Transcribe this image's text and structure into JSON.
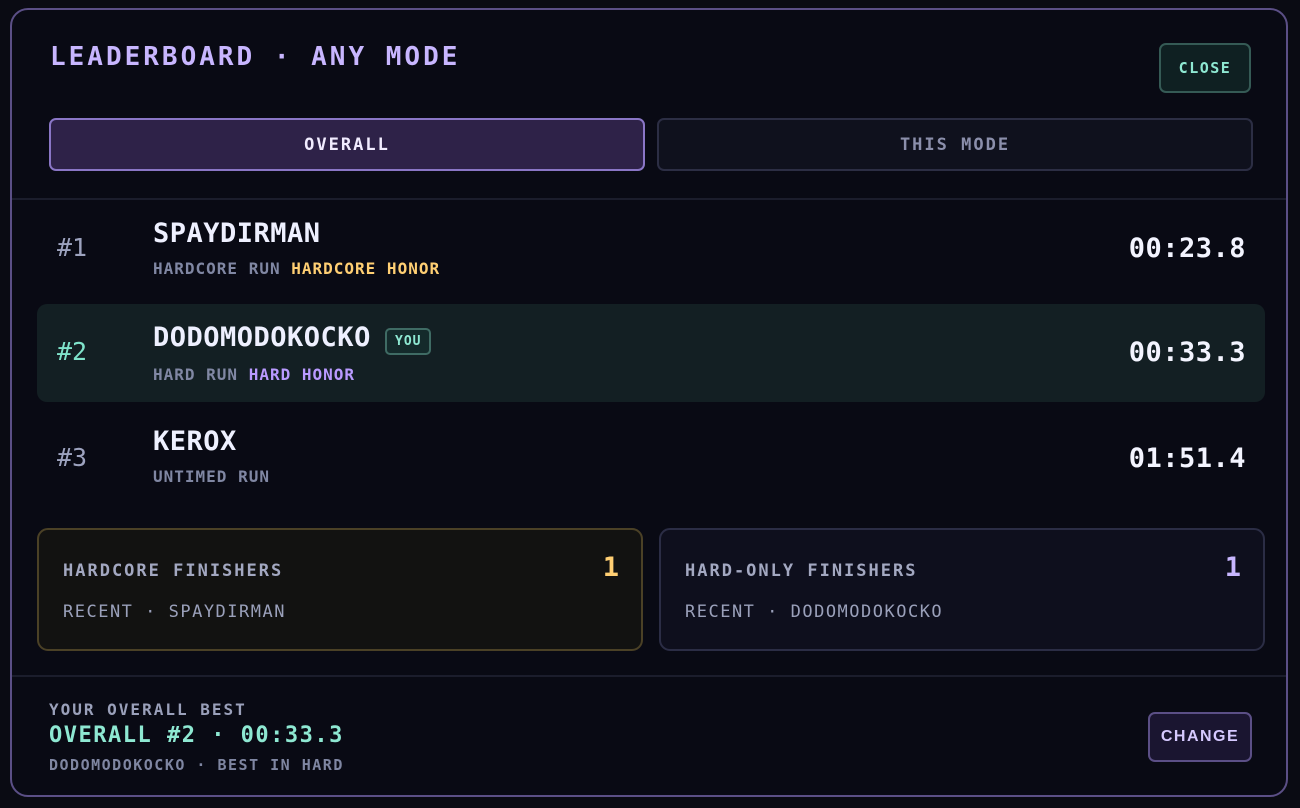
{
  "header": {
    "title": "LEADERBOARD · ANY MODE",
    "close_label": "CLOSE"
  },
  "tabs": [
    {
      "label": "OVERALL",
      "active": true
    },
    {
      "label": "THIS MODE",
      "active": false
    }
  ],
  "entries": [
    {
      "rank": "#1",
      "name": "SPAYDIRMAN",
      "run_type": "HARDCORE RUN",
      "honor": "HARDCORE HONOR",
      "time": "00:23.8",
      "is_you": false
    },
    {
      "rank": "#2",
      "name": "DODOMODOKOCKO",
      "run_type": "HARD RUN",
      "honor": "HARD HONOR",
      "time": "00:33.3",
      "is_you": true,
      "badge": "YOU"
    },
    {
      "rank": "#3",
      "name": "KEROX",
      "run_type": "UNTIMED RUN",
      "honor": "",
      "time": "01:51.4",
      "is_you": false
    }
  ],
  "stats": {
    "hardcore": {
      "label": "HARDCORE FINISHERS",
      "count": "1",
      "recent": "RECENT · SPAYDIRMAN"
    },
    "hard": {
      "label": "HARD-ONLY FINISHERS",
      "count": "1",
      "recent": "RECENT · DODOMODOKOCKO"
    }
  },
  "footer": {
    "label": "YOUR OVERALL BEST",
    "value": "OVERALL #2 · 00:33.3",
    "detail": "DODOMODOKOCKO · BEST IN HARD",
    "change_label": "CHANGE"
  },
  "colors": {
    "accent_purple": "#c8b6ff",
    "accent_teal": "#8ee8d2",
    "hardcore_gold": "#ffcf73",
    "hard_violet": "#b99aff",
    "background": "#090a14"
  }
}
